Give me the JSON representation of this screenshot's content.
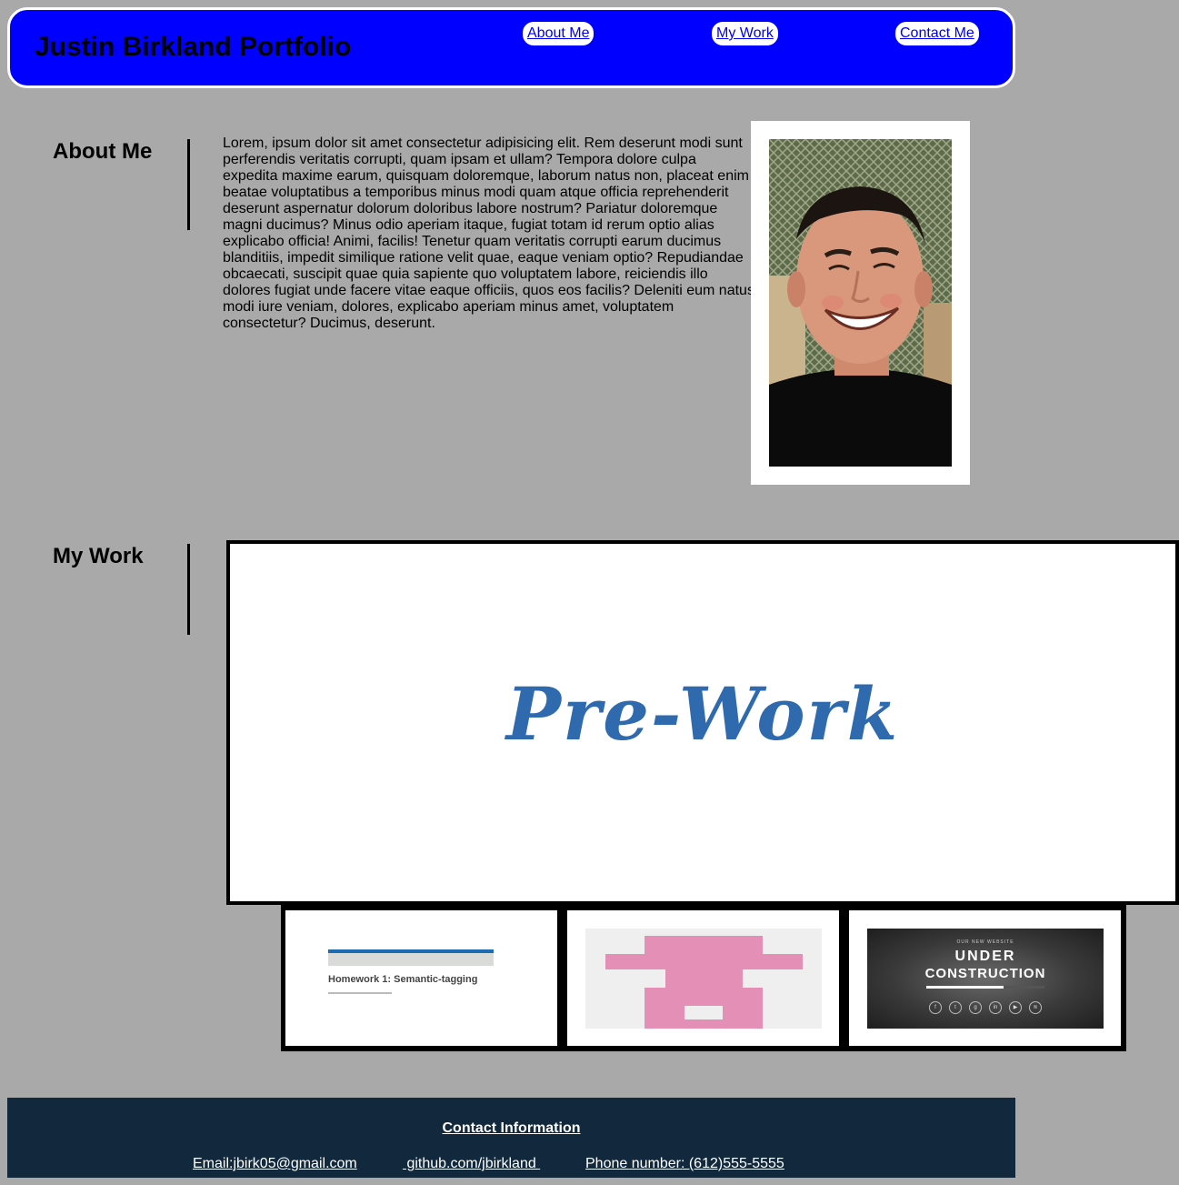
{
  "header": {
    "title": "Justin Birkland Portfolio",
    "nav": [
      "About Me",
      "My Work",
      "Contact Me"
    ]
  },
  "about": {
    "heading": "About Me",
    "body": "Lorem, ipsum dolor sit amet consectetur adipisicing elit. Rem deserunt modi sunt perferendis veritatis corrupti, quam ipsam et ullam? Tempora dolore culpa expedita maxime earum, quisquam doloremque, laborum natus non, placeat enim beatae voluptatibus a temporibus minus modi quam atque officia reprehenderit deserunt aspernatur dolorum doloribus labore nostrum? Pariatur doloremque magni ducimus? Minus odio aperiam itaque, fugiat totam id rerum optio alias explicabo officia! Animi, facilis! Tenetur quam veritatis corrupti earum ducimus blanditiis, impedit similique ratione velit quae, eaque veniam optio? Repudiandae obcaecati, suscipit quae quia sapiente quo voluptatem labore, reiciendis illo dolores fugiat unde facere vitae eaque officiis, quos eos facilis? Deleniti eum natus modi iure veniam, dolores, explicabo aperiam minus amet, voluptatem consectetur? Ducimus, deserunt."
  },
  "work": {
    "heading": "My Work",
    "featured_title": "Pre-Work",
    "thumbnails": {
      "homework_title": "Homework 1: Semantic-tagging",
      "under_small": "OUR NEW WEBSITE",
      "under_line1": "UNDER",
      "under_line2": "CONSTRUCTION",
      "under_progress": 0.65,
      "under_icons": [
        "f",
        "t",
        "g+",
        "in",
        "yt",
        "rss"
      ]
    }
  },
  "footer": {
    "heading": "Contact Information",
    "email": "Email:jbirk05@gmail.com",
    "github": " github.com/jbirkland ",
    "phone": "Phone number: (612)555-5555"
  },
  "colors": {
    "page_bg": "#a9a9a9",
    "header_bg": "#0000ff",
    "footer_bg": "#12283d",
    "prework_blue": "#2e6aad",
    "pink": "#e38fb6"
  }
}
